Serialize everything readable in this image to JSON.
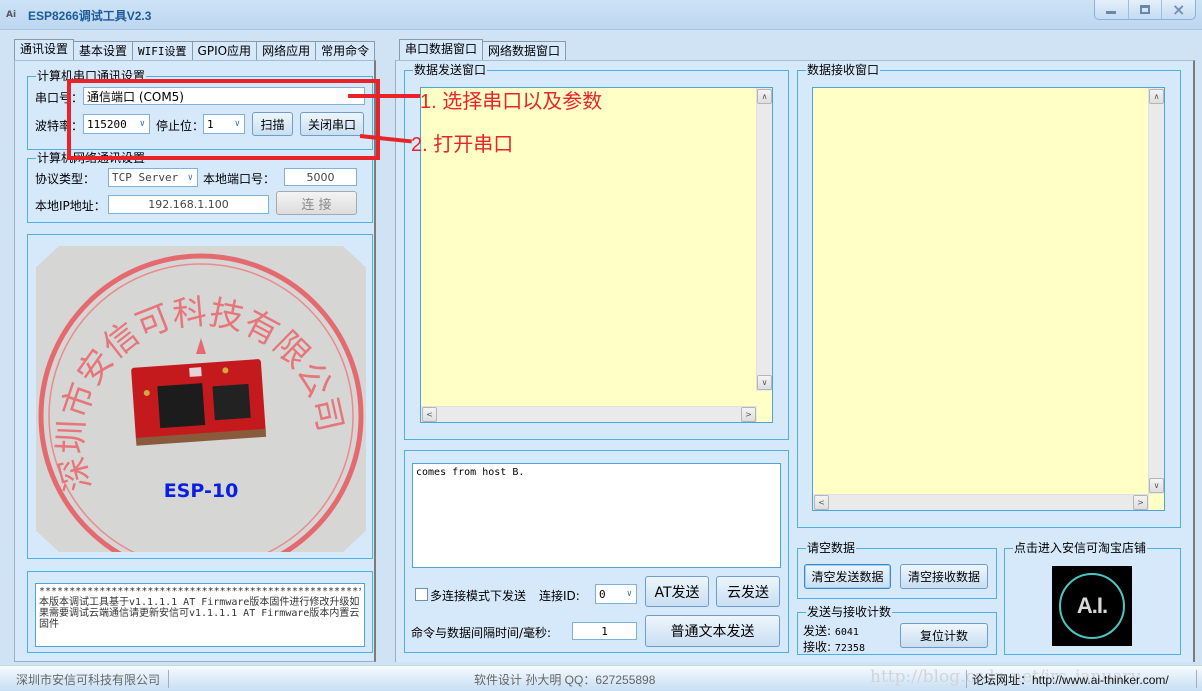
{
  "window": {
    "title": "ESP8266调试工具V2.3",
    "app_icon_text": "Ai",
    "minimize_icon": "minimize-icon",
    "maximize_icon": "maximize-icon",
    "close_icon": "×"
  },
  "left_tabs": [
    "通讯设置",
    "基本设置",
    "WIFI设置",
    "GPIO应用",
    "网络应用",
    "常用命令"
  ],
  "right_tabs": [
    "串口数据窗口",
    "网络数据窗口"
  ],
  "serial_group": {
    "legend": "计算机串口通讯设置",
    "port_label": "串口号：",
    "port_value": "通信端口 (COM5)",
    "baud_label": "波特率：",
    "baud_value": "115200",
    "stopbits_label": "停止位：",
    "stopbits_value": "1",
    "scan_button": "扫描",
    "close_port_button": "关闭串口"
  },
  "network_group": {
    "legend": "计算机网络通讯设置",
    "protocol_label": "协议类型：",
    "protocol_value": "TCP Server",
    "local_port_label": "本地端口号：",
    "local_port_value": "5000",
    "local_ip_label": "本地IP地址：",
    "local_ip_value": "192.168.1.100",
    "connect_button": "连 接"
  },
  "product_image": {
    "caption": "ESP-10",
    "stamp_text": "深圳市安信可科技有限公司"
  },
  "info_text": {
    "stars": "**********************************************************",
    "body": "本版本调试工具基于v1.1.1.1 AT Firmware版本固件进行修改升级如果需要调试云端通信请更新安信可v1.1.1.1 AT Firmware版本内置云固件"
  },
  "annotations": [
    {
      "text": "1. 选择串口以及参数"
    },
    {
      "text": "2. 打开串口"
    }
  ],
  "send_window": {
    "legend": "数据发送窗口",
    "content": ""
  },
  "receive_window": {
    "legend": "数据接收窗口",
    "content": ""
  },
  "send_input": {
    "value": "comes from host B."
  },
  "send_controls": {
    "multi_conn_label": "多连接模式下发送",
    "multi_conn_checked": false,
    "conn_id_label": "连接ID:",
    "conn_id_value": "0",
    "at_send_button": "AT发送",
    "cloud_send_button": "云发送",
    "interval_label": "命令与数据间隔时间/毫秒:",
    "interval_value": "1",
    "text_send_button": "普通文本发送"
  },
  "clear_group": {
    "legend": "请空数据",
    "clear_send_button": "清空发送数据",
    "clear_receive_button": "清空接收数据"
  },
  "count_group": {
    "legend": "发送与接收计数",
    "sent_label": "发送:",
    "sent_value": "6041",
    "received_label": "接收:",
    "received_value": "72358",
    "reset_button": "复位计数"
  },
  "shop_group": {
    "legend": "点击进入安信可淘宝店铺",
    "logo_text": "A.I."
  },
  "statusbar": {
    "company": "深圳市安信可科技有限公司",
    "designer": "软件设计 孙大明 QQ：627255898",
    "forum": "论坛网址：http://www.ai-thinker.com/",
    "watermark": "http://blog.csdn.net/jrs_january"
  },
  "colors": {
    "annotation_red": "#e8242a",
    "group_border": "#4fb0df",
    "text_area_yellow": "#ffffc6",
    "title_blue": "#1c5a9a",
    "caption_blue": "#0a1ee0"
  }
}
